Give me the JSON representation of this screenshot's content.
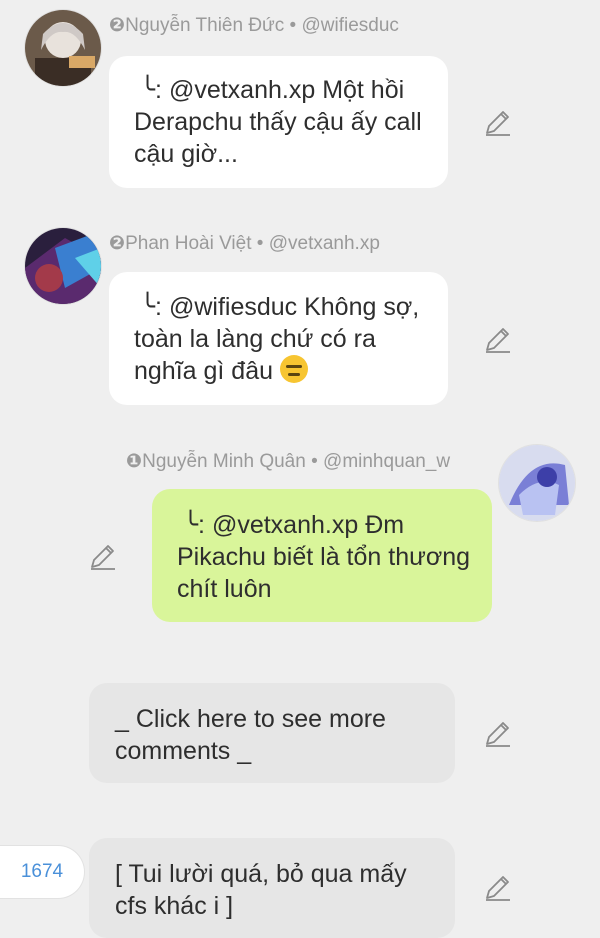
{
  "comments": [
    {
      "badge": "❷",
      "author": "Nguyễn Thiên Đức",
      "handle": "@wifiesduc",
      "reply_marker": "╰:",
      "text": "@vetxanh.xp Một hồi Derapchu thấy cậu ấy call cậu giờ..."
    },
    {
      "badge": "❷",
      "author": "Phan Hoài Việt",
      "handle": "@vetxanh.xp",
      "reply_marker": "╰:",
      "text": "@wifiesduc Không sợ, toàn la làng chứ có ra nghĩa gì đâu",
      "emoji": "expressionless-face"
    },
    {
      "badge": "❶",
      "author": "Nguyễn Minh Quân",
      "handle": "@minhquan_w",
      "reply_marker": "╰:",
      "text": "@vetxanh.xp Đm Pikachu biết là tổn thương chít luôn"
    }
  ],
  "more_comments": "_ Click here to see more comments _",
  "last_post": {
    "count": "1674",
    "text": "[ Tui lười quá, bỏ qua mấy cfs khác i ]"
  },
  "separator": " • ",
  "colors": {
    "background": "#efefef",
    "bubble": "#ffffff",
    "own_bubble": "#d9f59a",
    "system_bubble": "#e6e6e6",
    "meta_text": "#9a9a9a",
    "count_text": "#4a90d9"
  }
}
